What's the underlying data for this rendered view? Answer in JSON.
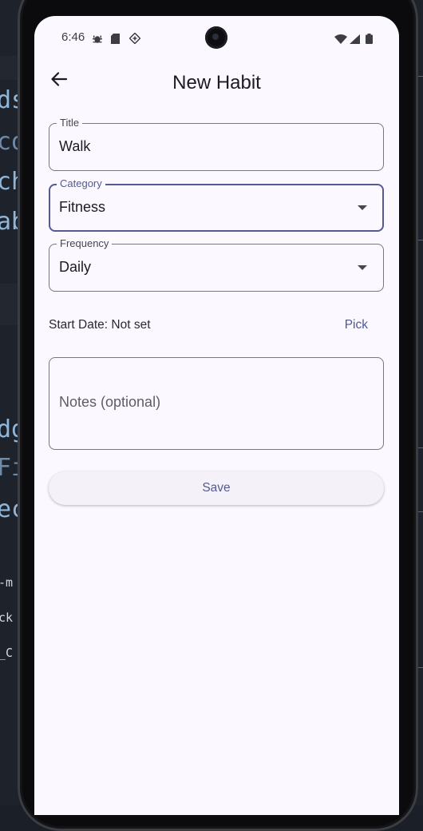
{
  "background": {
    "code_lines": [
      "ds",
      "co",
      "ch",
      "ab",
      "dg",
      "Fi",
      "ec"
    ],
    "code_lines_small": [
      "-m",
      "ck",
      "_C"
    ]
  },
  "status_bar": {
    "time": "6:46",
    "left_icons": [
      "bug-icon",
      "sd-card-icon",
      "diamond-notification-icon"
    ],
    "right_icons": [
      "wifi-icon",
      "cellular-signal-icon",
      "battery-icon"
    ]
  },
  "app_bar": {
    "back_icon": "arrow-back-icon",
    "title": "New Habit"
  },
  "form": {
    "title_field": {
      "label": "Title",
      "value": "Walk"
    },
    "category_field": {
      "label": "Category",
      "value": "Fitness",
      "focused": true
    },
    "frequency_field": {
      "label": "Frequency",
      "value": "Daily"
    },
    "start_date": {
      "text": "Start Date: Not set",
      "pick_label": "Pick"
    },
    "notes_field": {
      "placeholder": "Notes (optional)"
    },
    "save_label": "Save"
  },
  "colors": {
    "primary": "#545a92",
    "surface": "#fcf8ff",
    "outline": "#78767f"
  }
}
